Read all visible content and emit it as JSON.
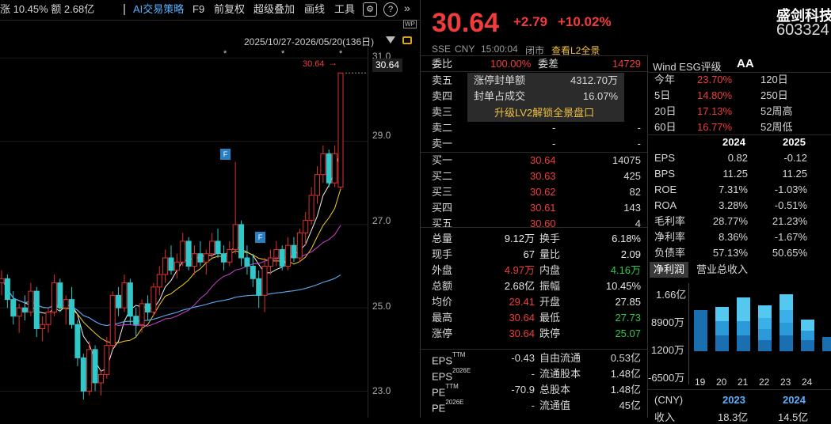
{
  "toolbar": {
    "left_text": "涨 10.45%  额 2.68亿",
    "items": [
      "AI交易策略",
      "F9",
      "前复权",
      "超级叠加",
      "画线",
      "工具"
    ],
    "settings_icon": "gear-icon",
    "help_icon": "question-icon",
    "expand_icon": "double-chevron-right-icon"
  },
  "chart_header": {
    "date_range": "2025/10/27-2026/05/20(136日)"
  },
  "chart": {
    "price_labels": [
      "31.0",
      "29.0",
      "27.0",
      "25.0",
      "23.0"
    ],
    "current_price": "30.64",
    "marker_label": "30.64",
    "event_markers": [
      "F",
      "F"
    ],
    "star_markers": [
      "*",
      "*",
      "*"
    ]
  },
  "chart_data": {
    "type": "candlestick",
    "y_tick_labels": [
      "31.0",
      "29.0",
      "27.0",
      "25.0",
      "23.0"
    ],
    "ylim": [
      22.8,
      31.1
    ],
    "last_close": 30.64,
    "candles": [
      [
        25.6,
        25.9,
        25.3,
        25.7
      ],
      [
        25.7,
        25.8,
        25.0,
        25.2
      ],
      [
        25.2,
        25.4,
        24.6,
        24.8
      ],
      [
        24.8,
        25.1,
        24.4,
        25.0
      ],
      [
        25.0,
        25.3,
        24.7,
        24.9
      ],
      [
        24.9,
        25.6,
        24.8,
        25.4
      ],
      [
        25.4,
        25.5,
        24.3,
        24.5
      ],
      [
        24.5,
        24.8,
        24.2,
        24.6
      ],
      [
        24.6,
        25.0,
        24.4,
        24.9
      ],
      [
        24.9,
        25.8,
        24.8,
        25.6
      ],
      [
        25.6,
        25.7,
        24.9,
        25.0
      ],
      [
        25.0,
        25.3,
        24.6,
        25.2
      ],
      [
        25.2,
        25.5,
        24.5,
        24.6
      ],
      [
        24.6,
        24.7,
        23.6,
        23.8
      ],
      [
        23.8,
        23.9,
        22.8,
        23.0
      ],
      [
        23.0,
        24.2,
        22.9,
        24.0
      ],
      [
        24.0,
        24.1,
        23.0,
        23.2
      ],
      [
        23.2,
        23.5,
        22.9,
        23.4
      ],
      [
        23.4,
        24.3,
        23.3,
        24.1
      ],
      [
        24.1,
        25.4,
        24.0,
        25.3
      ],
      [
        25.3,
        25.5,
        24.8,
        25.0
      ],
      [
        25.0,
        25.8,
        24.9,
        25.6
      ],
      [
        25.6,
        25.7,
        24.6,
        24.8
      ],
      [
        24.8,
        25.0,
        24.3,
        24.6
      ],
      [
        24.6,
        25.2,
        24.4,
        25.1
      ],
      [
        25.1,
        25.3,
        24.7,
        24.9
      ],
      [
        24.9,
        25.6,
        24.8,
        25.5
      ],
      [
        25.5,
        26.0,
        25.3,
        25.8
      ],
      [
        25.8,
        26.4,
        25.6,
        26.2
      ],
      [
        26.2,
        26.5,
        25.8,
        25.9
      ],
      [
        25.9,
        26.3,
        25.7,
        26.1
      ],
      [
        26.1,
        26.8,
        26.0,
        26.6
      ],
      [
        26.6,
        26.7,
        25.9,
        26.0
      ],
      [
        26.0,
        26.5,
        25.8,
        26.3
      ],
      [
        26.3,
        26.6,
        26.0,
        26.1
      ],
      [
        26.1,
        26.4,
        25.8,
        26.3
      ],
      [
        26.3,
        26.8,
        26.2,
        26.6
      ],
      [
        26.6,
        26.9,
        26.2,
        26.3
      ],
      [
        26.3,
        26.5,
        25.9,
        26.1
      ],
      [
        26.1,
        26.6,
        26.0,
        26.4
      ],
      [
        26.4,
        28.5,
        26.3,
        27.0
      ],
      [
        27.0,
        27.1,
        26.0,
        26.2
      ],
      [
        26.2,
        26.5,
        25.8,
        26.0
      ],
      [
        26.0,
        26.3,
        25.5,
        25.7
      ],
      [
        25.7,
        25.9,
        25.0,
        25.3
      ],
      [
        25.3,
        26.2,
        24.9,
        26.0
      ],
      [
        26.0,
        26.4,
        25.8,
        26.2
      ],
      [
        26.2,
        26.6,
        26.0,
        26.4
      ],
      [
        26.4,
        26.5,
        25.9,
        26.0
      ],
      [
        26.0,
        26.7,
        25.9,
        26.5
      ],
      [
        26.5,
        26.7,
        26.1,
        26.2
      ],
      [
        26.2,
        26.9,
        26.1,
        26.8
      ],
      [
        26.8,
        27.3,
        26.5,
        27.1
      ],
      [
        27.1,
        27.9,
        27.0,
        27.7
      ],
      [
        27.7,
        28.4,
        27.5,
        28.2
      ],
      [
        28.2,
        28.9,
        28.0,
        28.7
      ],
      [
        28.7,
        28.8,
        27.9,
        28.0
      ],
      [
        28.0,
        28.9,
        27.9,
        28.7
      ],
      [
        27.9,
        30.64,
        27.85,
        30.64
      ]
    ]
  },
  "stock": {
    "name": "盛剑科技",
    "code": "603324",
    "price": "30.64",
    "change": "+2.79",
    "change_pct": "+10.02%",
    "exchange": "SSE",
    "currency": "CNY",
    "time": "15:00:04",
    "status": "闭市",
    "l2_link": "查看L2全景"
  },
  "orderbook": {
    "weibi_label": "委比",
    "weibi": "100.00%",
    "weicha_label": "委差",
    "weicha": "14729",
    "sells": [
      {
        "label": "卖五",
        "price": "",
        "vol": ""
      },
      {
        "label": "卖四",
        "price": "",
        "vol": ""
      },
      {
        "label": "卖三",
        "price": "",
        "vol": ""
      },
      {
        "label": "卖二",
        "price": "-",
        "vol": "-"
      },
      {
        "label": "卖一",
        "price": "-",
        "vol": "-"
      }
    ],
    "popup": {
      "r1_label": "涨停封单额",
      "r1_val": "4312.70万",
      "r2_label": "封单占成交",
      "r2_val": "16.07%",
      "link": "升级LV2解锁全景盘口"
    },
    "buys": [
      {
        "label": "买一",
        "price": "30.64",
        "vol": "14075"
      },
      {
        "label": "买二",
        "price": "30.63",
        "vol": "425"
      },
      {
        "label": "买三",
        "price": "30.62",
        "vol": "82"
      },
      {
        "label": "买四",
        "price": "30.61",
        "vol": "143"
      },
      {
        "label": "买五",
        "price": "30.60",
        "vol": "4"
      }
    ]
  },
  "stats": [
    {
      "l1": "总量",
      "v1": "9.12万",
      "c1": "white",
      "l2": "换手",
      "v2": "6.18%",
      "c2": "white"
    },
    {
      "l1": "现手",
      "v1": "67",
      "c1": "white",
      "l2": "量比",
      "v2": "2.09",
      "c2": "white"
    },
    {
      "l1": "外盘",
      "v1": "4.97万",
      "c1": "red",
      "l2": "内盘",
      "v2": "4.16万",
      "c2": "green"
    },
    {
      "l1": "总额",
      "v1": "2.68亿",
      "c1": "white",
      "l2": "振幅",
      "v2": "10.45%",
      "c2": "white"
    },
    {
      "l1": "均价",
      "v1": "29.41",
      "c1": "red",
      "l2": "开盘",
      "v2": "27.85",
      "c2": "white"
    },
    {
      "l1": "最高",
      "v1": "30.64",
      "c1": "red",
      "l2": "最低",
      "v2": "27.73",
      "c2": "green"
    },
    {
      "l1": "涨停",
      "v1": "30.64",
      "c1": "red",
      "l2": "跌停",
      "v2": "25.07",
      "c2": "green"
    }
  ],
  "fund": [
    {
      "l1": "EPS",
      "s1": "TTM",
      "v1": "-0.43",
      "l2": "自由流通",
      "v2": "0.53亿"
    },
    {
      "l1": "EPS",
      "s1": "2026E",
      "v1": "-",
      "l2": "流通股本",
      "v2": "1.48亿"
    },
    {
      "l1": "PE",
      "s1": "TTM",
      "v1": "-70.9",
      "l2": "总股本",
      "v2": "1.48亿"
    },
    {
      "l1": "PE",
      "s1": "2026E",
      "v1": "-",
      "l2": "流通值",
      "v2": "45亿"
    }
  ],
  "esg": {
    "label": "Wind ESG评级",
    "rating": "AA"
  },
  "returns": [
    {
      "l1": "今年",
      "v1": "23.70%",
      "l2": "120日",
      "v2": ""
    },
    {
      "l1": "5日",
      "v1": "14.80%",
      "l2": "250日",
      "v2": ""
    },
    {
      "l1": "20日",
      "v1": "17.13%",
      "l2": "52周高",
      "v2": ""
    },
    {
      "l1": "60日",
      "v1": "16.77%",
      "l2": "52周低",
      "v2": ""
    }
  ],
  "fin_table": {
    "years": [
      "2024",
      "2025"
    ],
    "rows": [
      {
        "label": "EPS",
        "a": "0.82",
        "b": "-0.12"
      },
      {
        "label": "BPS",
        "a": "11.25",
        "b": "11.25"
      },
      {
        "label": "ROE",
        "a": "7.31%",
        "b": "-1.03%"
      },
      {
        "label": "ROA",
        "a": "3.28%",
        "b": "-0.51%"
      },
      {
        "label": "毛利率",
        "a": "28.77%",
        "b": "21.23%"
      },
      {
        "label": "净利率",
        "a": "8.36%",
        "b": "-1.67%"
      },
      {
        "label": "负债率",
        "a": "57.13%",
        "b": "50.65%"
      }
    ]
  },
  "fin_tabs": [
    "净利润",
    "营业总收入"
  ],
  "bar_chart": {
    "y_labels": [
      "1.66亿",
      "8900万",
      "1200万",
      "-6500万"
    ],
    "x_labels": [
      "19",
      "20",
      "21",
      "22",
      "23",
      "24"
    ],
    "year_labels": [
      "2023",
      "2024"
    ],
    "currency_label": "(CNY)",
    "bottom_label": "收入",
    "bottom_vals": [
      "18.3亿",
      "14.5亿"
    ]
  }
}
